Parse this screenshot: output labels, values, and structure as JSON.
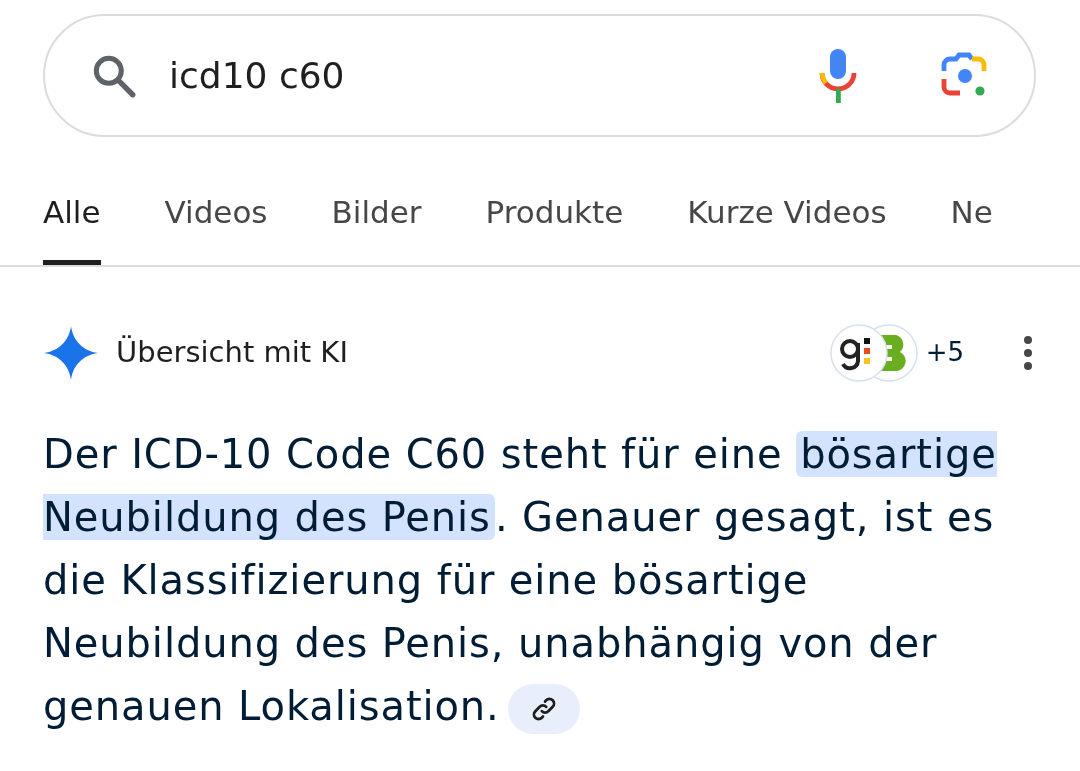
{
  "search": {
    "value": "icd10 c60"
  },
  "tabs": [
    {
      "label": "Alle",
      "selected": true
    },
    {
      "label": "Videos",
      "selected": false
    },
    {
      "label": "Bilder",
      "selected": false
    },
    {
      "label": "Produkte",
      "selected": false
    },
    {
      "label": "Kurze Videos",
      "selected": false
    },
    {
      "label": "Ne",
      "selected": false
    }
  ],
  "overview": {
    "title": "Übersicht mit KI",
    "source_count": "+5",
    "paragraph": [
      {
        "text": "Der ICD-10 Code C60 steht für eine ",
        "highlighted": false
      },
      {
        "text": "bösartige Neubildung des Penis",
        "highlighted": true
      },
      {
        "text": ". Genauer gesagt, ist es die Klassifizierung für eine bösartige Neubildung des Penis, unabhängig von der genauen Lokalisation.",
        "highlighted": false
      }
    ]
  }
}
